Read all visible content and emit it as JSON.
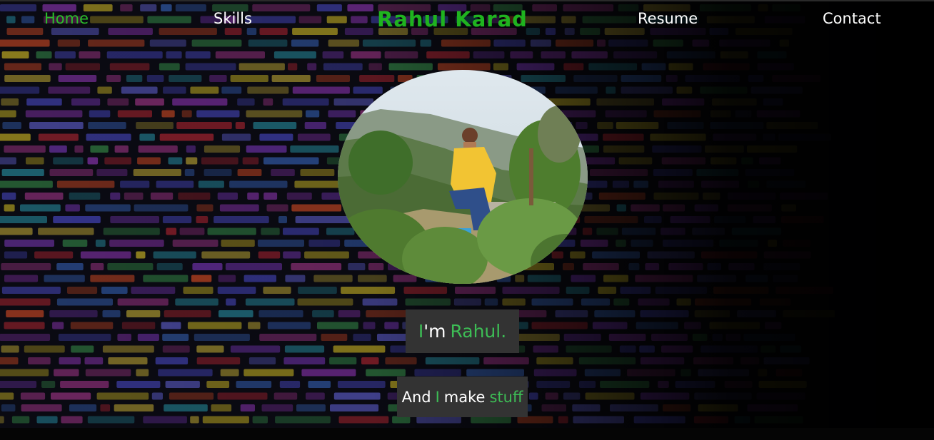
{
  "nav": {
    "home": "Home",
    "skills": "Skills",
    "brand": "Rahul Karad",
    "resume": "Resume",
    "contact": "Contact"
  },
  "hero": {
    "intro_i": "I",
    "intro_am": "'m",
    "intro_name": "Rahul.",
    "tagline_and": "And",
    "tagline_i": "I",
    "tagline_make": "make",
    "tagline_stuff": "stuff"
  },
  "icons": {
    "profile_photo": "profile-photo",
    "background": "code-background-image"
  },
  "colors": {
    "accent_green": "#2bbf2b",
    "brand_green": "#1fb31f",
    "box_bg": "#333333",
    "page_bg": "#000000",
    "text": "#ffffff"
  }
}
